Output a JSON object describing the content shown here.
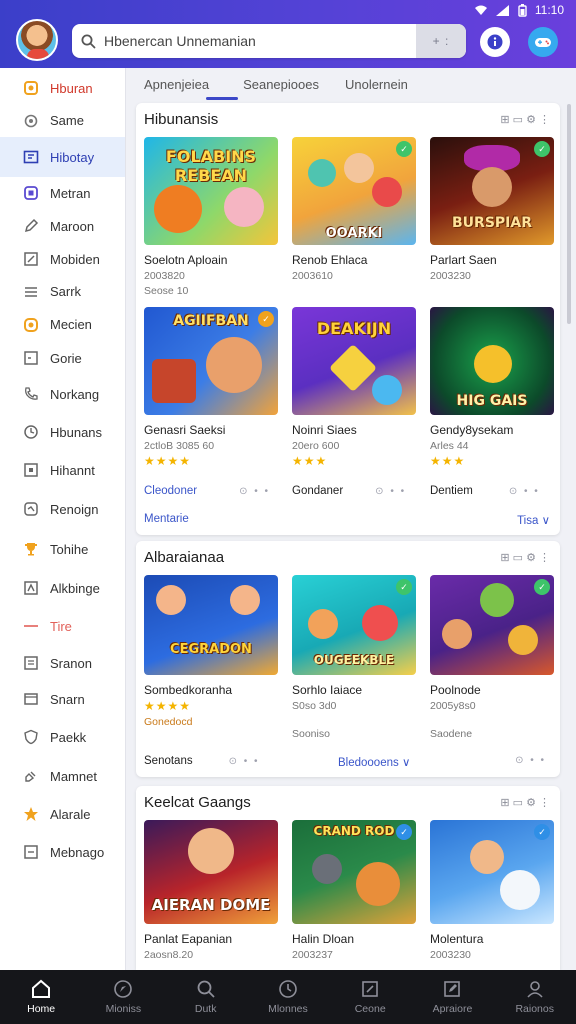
{
  "status": {
    "time": "11:10"
  },
  "header": {
    "search_text": "Hbenercan Unnemanian",
    "search_action": "+ :"
  },
  "sidebar": {
    "items": [
      {
        "label": "Hburan",
        "icon": "home-icon"
      },
      {
        "label": "Same",
        "icon": "gear-icon"
      },
      {
        "label": "Hibotay",
        "icon": "library-icon"
      },
      {
        "label": "Metran",
        "icon": "square-icon"
      },
      {
        "label": "Maroon",
        "icon": "pencil-icon"
      },
      {
        "label": "Mobiden",
        "icon": "grid-icon"
      },
      {
        "label": "Sarrk",
        "icon": "list-icon"
      },
      {
        "label": "Mecien",
        "icon": "sun-icon"
      },
      {
        "label": "Gorie",
        "icon": "folder-icon"
      },
      {
        "label": "Norkang",
        "icon": "phone-icon"
      },
      {
        "label": "Hbunans",
        "icon": "clock-icon"
      },
      {
        "label": "Hihannt",
        "icon": "box-icon"
      },
      {
        "label": "Renoign",
        "icon": "chat-icon"
      },
      {
        "label": "Tohihe",
        "icon": "trophy-icon"
      },
      {
        "label": "Alkbinge",
        "icon": "tag-icon"
      },
      {
        "label": "Tire",
        "icon": "dash-icon"
      },
      {
        "label": "Sranon",
        "icon": "note-icon"
      },
      {
        "label": "Snarn",
        "icon": "card-icon"
      },
      {
        "label": "Paekk",
        "icon": "shield-icon"
      },
      {
        "label": "Mamnet",
        "icon": "puzzle-icon"
      },
      {
        "label": "Alarale",
        "icon": "star-icon"
      },
      {
        "label": "Mebnago",
        "icon": "settings-icon"
      }
    ]
  },
  "tabs": [
    "Apnenjeiea",
    "Seanepiooes",
    "Unolernein"
  ],
  "sections": [
    {
      "title": "Hibunansis",
      "tools": "⊞ ▭ ⚙ ⋮",
      "games": [
        {
          "name": "Soelotn Aploain",
          "sub": "2003820",
          "sub2": "Seose 10",
          "art": "FOLABINS REBEAN",
          "colors": [
            "#21b7e6",
            "#f5c33a"
          ]
        },
        {
          "name": "Renob Ehlaca",
          "sub": "2003610",
          "sub2": "",
          "art": "OOARKI",
          "colors": [
            "#f1c52a",
            "#6fb9ef"
          ]
        },
        {
          "name": "Parlart Saen",
          "sub": "2003230",
          "sub2": "",
          "art": "BURSPIAR",
          "colors": [
            "#3a1410",
            "#b43a1a"
          ]
        },
        {
          "name": "Genasri Saeksi",
          "sub": "2ctloB 3085 60",
          "stars": "★★★★",
          "art": "AGIIFBAN",
          "colors": [
            "#2b5fd6",
            "#f29a2e"
          ]
        },
        {
          "name": "Noinri Siaes",
          "sub": "20ero 600",
          "stars": "★★★",
          "art": "DEAKIJN",
          "colors": [
            "#7b3ad6",
            "#f2c94c"
          ]
        },
        {
          "name": "Gendy8ysekam",
          "sub": "Arles 44",
          "stars": "★★★",
          "art": "HIG GAIS",
          "colors": [
            "#0f6a38",
            "#3a1f5a"
          ]
        }
      ],
      "footer": {
        "left1": "Cleodoner",
        "left2": "Gondaner",
        "left3": "Dentiem",
        "more_left": "Mentarie",
        "more_right": "Tisa ∨"
      }
    },
    {
      "title": "Albaraianaa",
      "tools": "⊞ ▭ ⚙ ⋮",
      "games": [
        {
          "name": "Sombedkoranha",
          "sub": "",
          "stars": "★★★★",
          "art": "CEGRADON",
          "colors": [
            "#1d4fb8",
            "#f0a72b"
          ]
        },
        {
          "name": "Sorhlo Iaiace",
          "sub": "S0so 3d0",
          "stars": "",
          "art": "OUGEEKBLE",
          "colors": [
            "#2ccbd6",
            "#f5d44c"
          ]
        },
        {
          "name": "Poolnode",
          "sub": "2005y8s0",
          "stars": "",
          "art": "",
          "colors": [
            "#6b2ca8",
            "#d94f2a"
          ]
        }
      ],
      "orange_label": "Gonedocd",
      "sub_mid": "Sooniso",
      "sub_right": "Saodene",
      "footer": {
        "left": "Senotans",
        "middle": "Bledoooens ∨"
      }
    },
    {
      "title": "Keelcat Gaangs",
      "tools": "⊞ ▭ ⚙ ⋮",
      "games": [
        {
          "name": "Panlat Eapanian",
          "sub": "2aosn8.20",
          "art": "AIERAN DOME",
          "colors": [
            "#b8242a",
            "#3b1a5c"
          ]
        },
        {
          "name": "Halin Dloan",
          "sub": "2003237",
          "art": "CRAND ROD",
          "colors": [
            "#1f7a3f",
            "#e0a23a"
          ]
        },
        {
          "name": "Molentura",
          "sub": "2003230",
          "art": "",
          "colors": [
            "#2a74d6",
            "#c9e6ff"
          ]
        }
      ]
    }
  ],
  "bottom_nav": [
    "Home",
    "Mioniss",
    "Dutk",
    "Mlonnes",
    "Ceone",
    "Apraiore",
    "Raionos"
  ]
}
